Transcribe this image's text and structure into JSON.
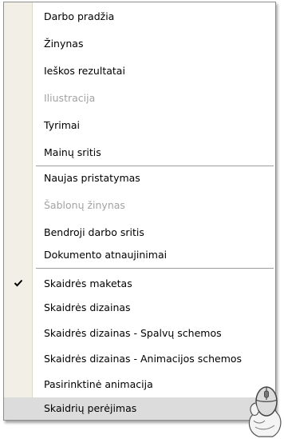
{
  "menu": {
    "items": [
      {
        "label": "Darbo pradžia",
        "disabled": false,
        "checked": false
      },
      {
        "label": "Žinynas",
        "disabled": false,
        "checked": false
      },
      {
        "label": "Ieškos rezultatai",
        "disabled": false,
        "checked": false
      },
      {
        "label": "Iliustracija",
        "disabled": true,
        "checked": false
      },
      {
        "label": "Tyrimai",
        "disabled": false,
        "checked": false
      },
      {
        "label": "Mainų sritis",
        "disabled": false,
        "checked": false
      },
      {
        "label": "Naujas pristatymas",
        "disabled": false,
        "checked": false
      },
      {
        "label": "Šablonų žinynas",
        "disabled": true,
        "checked": false
      },
      {
        "label": "Bendroji darbo sritis",
        "disabled": false,
        "checked": false
      },
      {
        "label": "Dokumento atnaujinimai",
        "disabled": false,
        "checked": false
      },
      {
        "label": "Skaidrės maketas",
        "disabled": false,
        "checked": true
      },
      {
        "label": "Skaidrės dizainas",
        "disabled": false,
        "checked": false
      },
      {
        "label": "Skaidrės dizainas - Spalvų schemos",
        "disabled": false,
        "checked": false
      },
      {
        "label": "Skaidrės dizainas - Animacijos schemos",
        "disabled": false,
        "checked": false
      },
      {
        "label": "Pasirinktinė animacija",
        "disabled": false,
        "checked": false
      },
      {
        "label": "Skaidrių perėjimas",
        "disabled": false,
        "checked": false,
        "highlighted": true
      }
    ]
  },
  "icons": {
    "check": "check-icon",
    "cursor": "mouse-pointer-icon"
  },
  "colors": {
    "gutter": "#f1efe6",
    "disabled_text": "#a3a3a3",
    "highlight": "#dcdcdc"
  }
}
